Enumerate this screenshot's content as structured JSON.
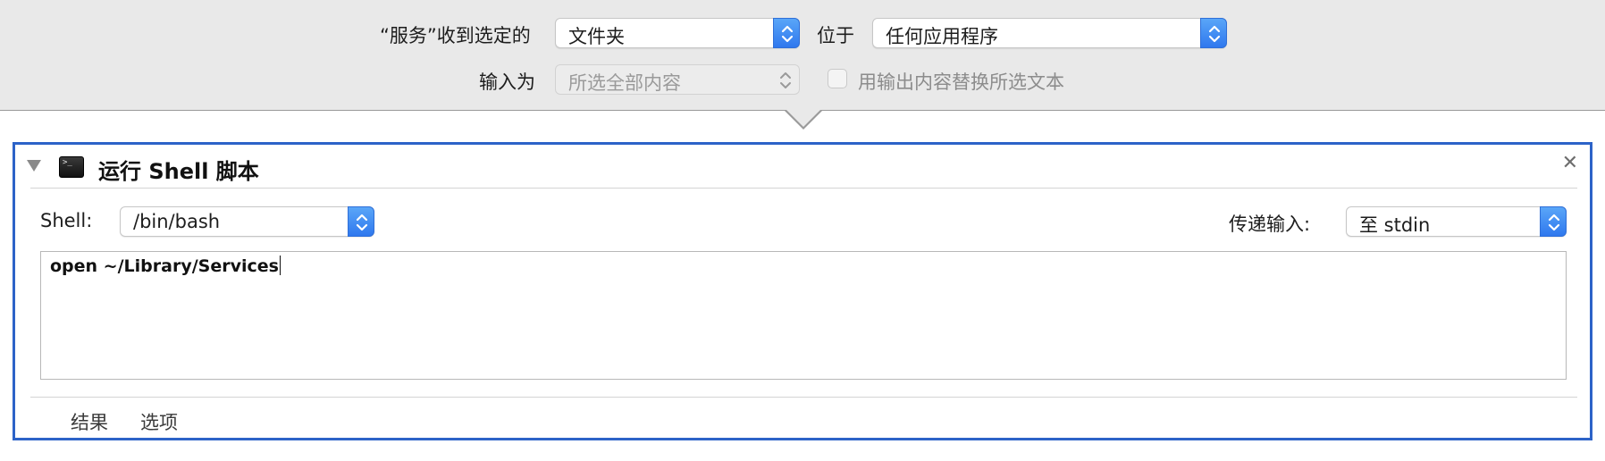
{
  "header": {
    "service_receives_label": "“服务”收到选定的",
    "service_receives_value": "文件夹",
    "location_label": "位于",
    "location_value": "任何应用程序",
    "input_is_label": "输入为",
    "input_is_value": "所选全部内容",
    "replace_checkbox_label": "用输出内容替换所选文本",
    "replace_checkbox_checked": false
  },
  "action": {
    "title": "运行 Shell 脚本",
    "shell_label": "Shell:",
    "shell_value": "/bin/bash",
    "pass_input_label": "传递输入:",
    "pass_input_value": "至 stdin",
    "script": "open ~/Library/Services",
    "tabs": [
      "结果",
      "选项"
    ],
    "icons": {
      "collapse": "disclosure-triangle-icon",
      "app": "terminal-icon",
      "close": "close-icon"
    }
  },
  "colors": {
    "header_bg": "#e9e9e9",
    "accent_blue": "#2f78ee",
    "panel_border": "#2d63c8"
  }
}
